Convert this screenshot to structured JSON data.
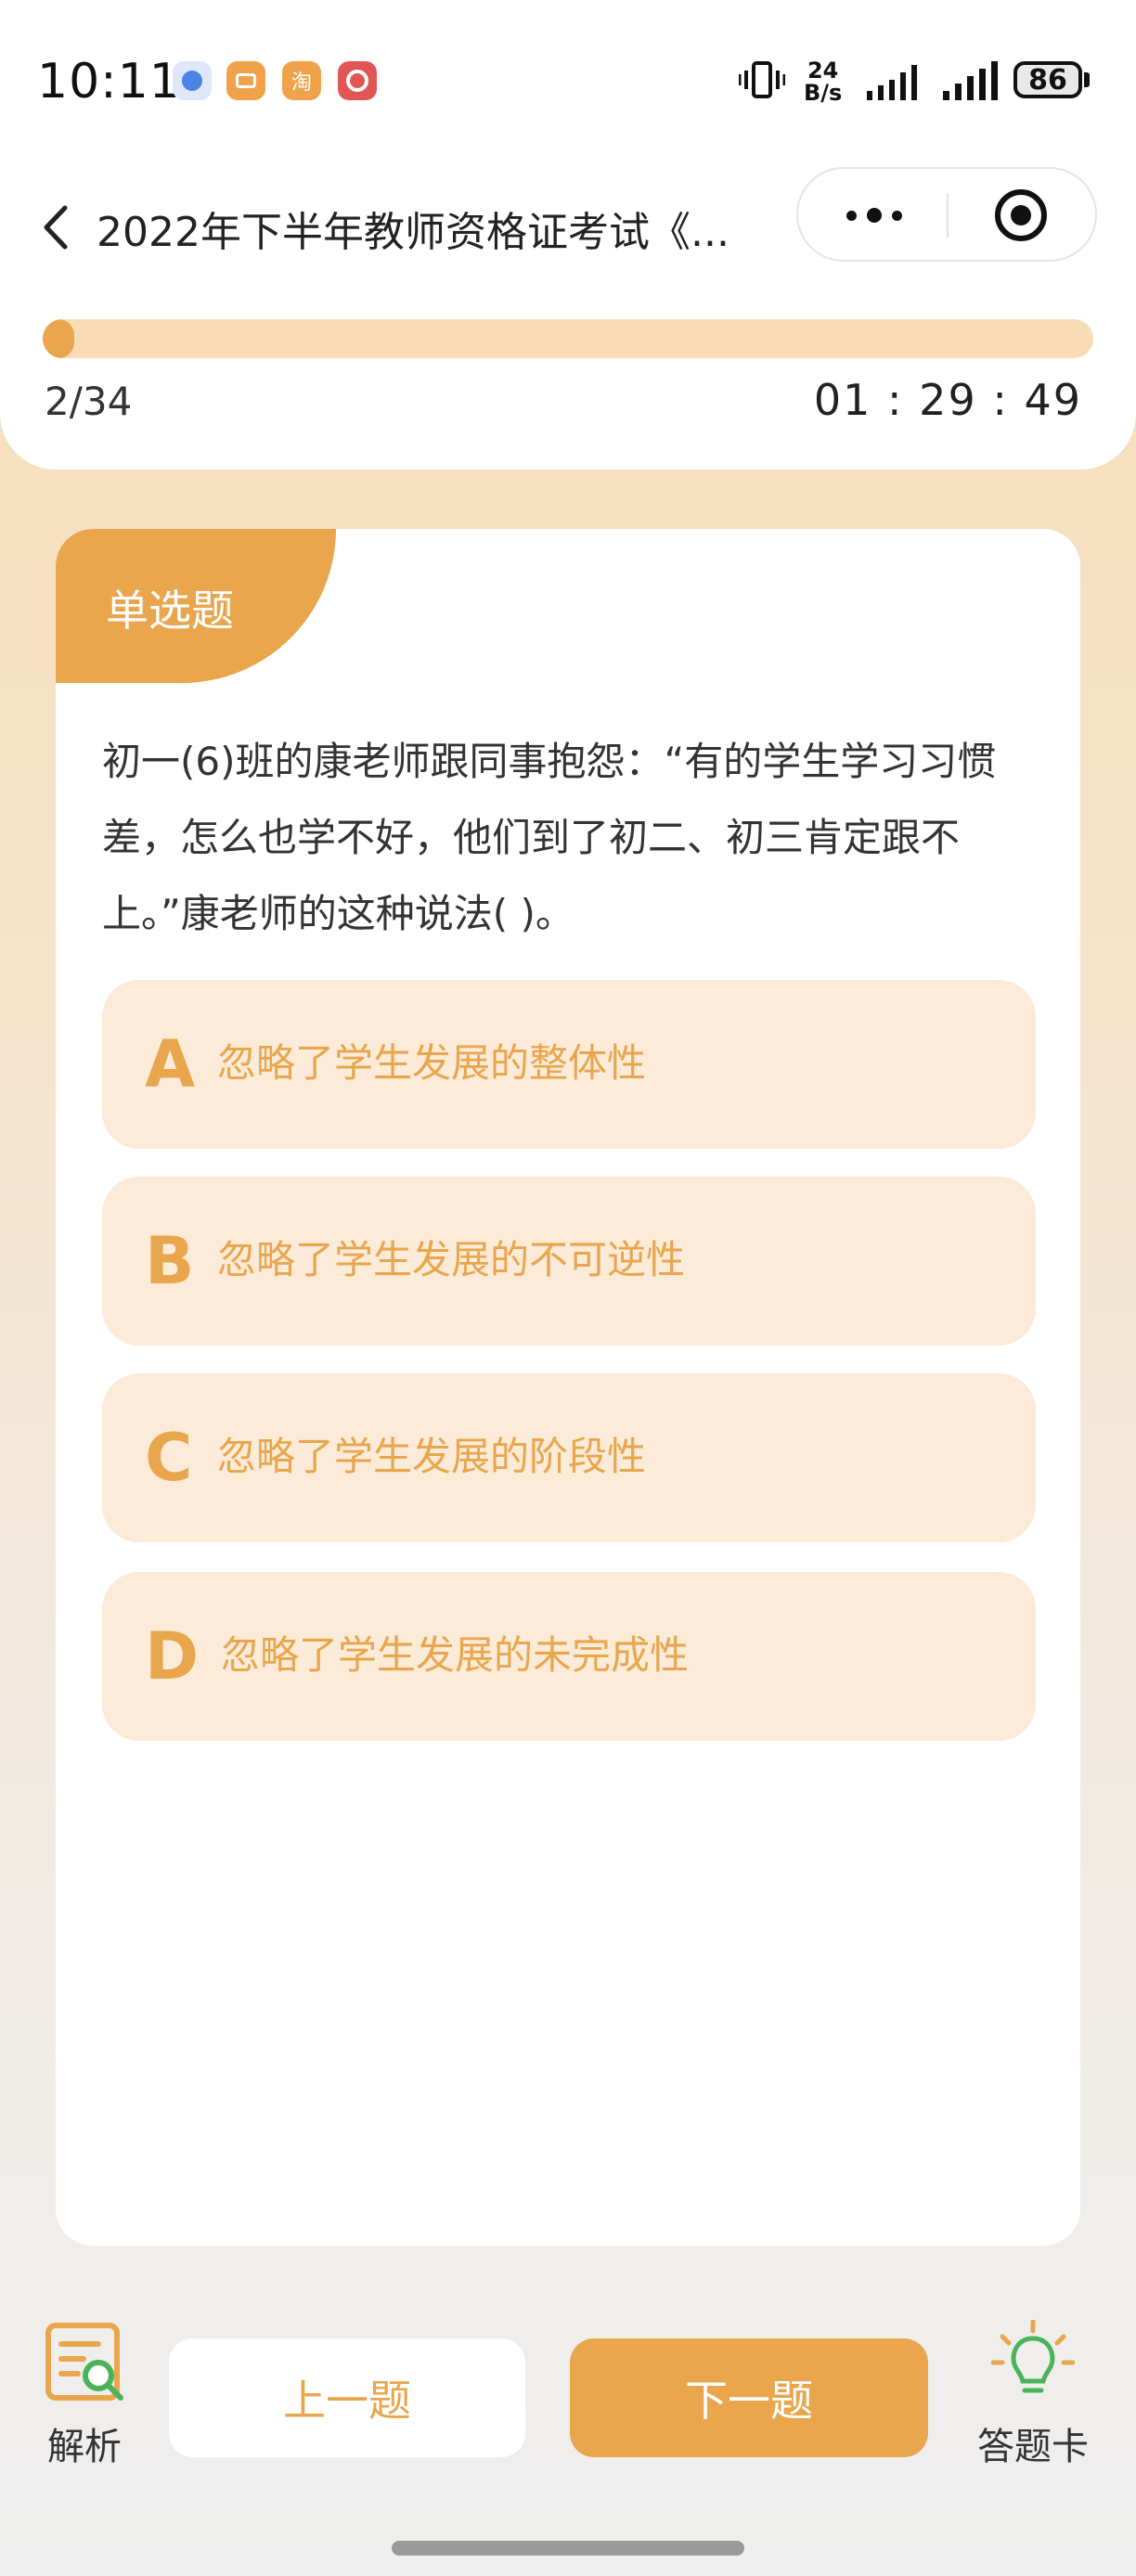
{
  "status_bar": {
    "time": "10:11",
    "app_icons": [
      {
        "name": "blue-app-icon",
        "glyph": "⬆",
        "color": "#4f82e6"
      },
      {
        "name": "message-app-icon",
        "glyph": "▤",
        "color": "#f0a24a"
      },
      {
        "name": "taobao-app-icon",
        "glyph": "淘",
        "color": "#f0a24a"
      },
      {
        "name": "bank-app-icon",
        "glyph": "◎",
        "color": "#e25555"
      }
    ],
    "net_speed_value": "24",
    "net_speed_unit": "B/s",
    "battery": "86"
  },
  "nav": {
    "title": "2022年下半年教师资格证考试《..."
  },
  "progress": {
    "current": 2,
    "total": 34,
    "label": "2/34",
    "timer": "01 : 29 : 49"
  },
  "question": {
    "type": "单选题",
    "stem": "初一(6)班的康老师跟同事抱怨：“有的学生学习习惯差，怎么也学不好，他们到了初二、初三肯定跟不上。”康老师的这种说法( )。",
    "options": [
      {
        "letter": "A",
        "text": "忽略了学生发展的整体性"
      },
      {
        "letter": "B",
        "text": "忽略了学生发展的不可逆性"
      },
      {
        "letter": "C",
        "text": "忽略了学生发展的阶段性"
      },
      {
        "letter": "D",
        "text": "忽略了学生发展的未完成性"
      }
    ]
  },
  "bottom": {
    "analysis_label": "解析",
    "prev_label": "上一题",
    "next_label": "下一题",
    "answer_card_label": "答题卡"
  },
  "colors": {
    "accent": "#e9a64d",
    "option_bg": "#fbebd8",
    "progress_track": "#f8dcb6"
  }
}
